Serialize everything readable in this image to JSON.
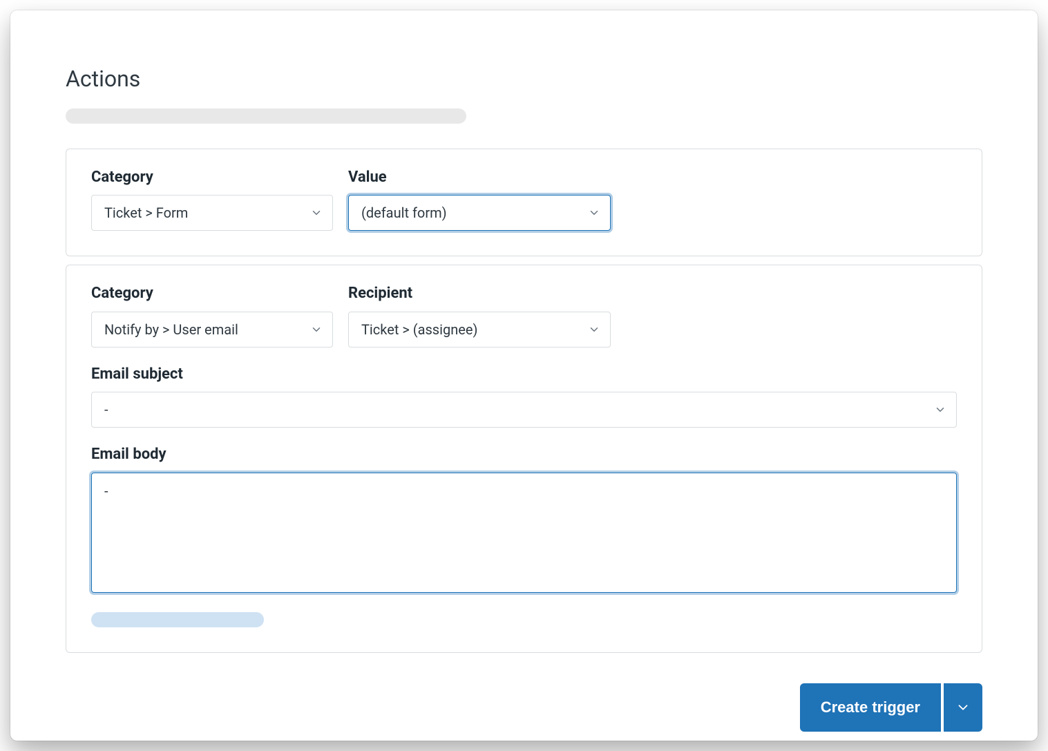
{
  "header": {
    "title": "Actions"
  },
  "action1": {
    "category_label": "Category",
    "category_value": "Ticket > Form",
    "value_label": "Value",
    "value_value": "(default form)"
  },
  "action2": {
    "category_label": "Category",
    "category_value": "Notify by > User email",
    "recipient_label": "Recipient",
    "recipient_value": "Ticket > (assignee)",
    "subject_label": "Email subject",
    "subject_value": "-",
    "body_label": "Email body",
    "body_value": "-"
  },
  "footer": {
    "create_trigger_label": "Create trigger"
  }
}
